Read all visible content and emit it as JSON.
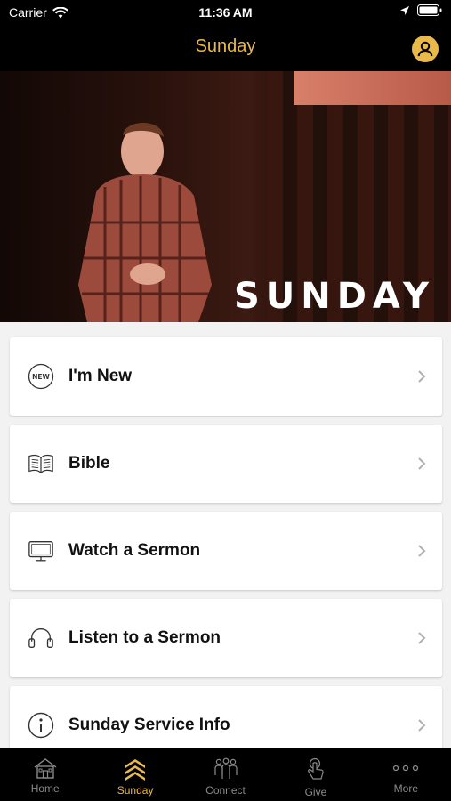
{
  "status_bar": {
    "carrier": "Carrier",
    "time": "11:36 AM"
  },
  "header": {
    "title": "Sunday",
    "profile_icon": "user-circle-icon"
  },
  "hero": {
    "title": "SUNDAY"
  },
  "menu": {
    "items": [
      {
        "label": "I'm New",
        "icon": "new-badge-icon",
        "icon_text": "NEW"
      },
      {
        "label": "Bible",
        "icon": "book-icon"
      },
      {
        "label": "Watch a Sermon",
        "icon": "monitor-icon"
      },
      {
        "label": "Listen to a Sermon",
        "icon": "headphones-icon"
      },
      {
        "label": "Sunday Service Info",
        "icon": "info-icon"
      }
    ]
  },
  "tabs": [
    {
      "label": "Home",
      "icon": "house-icon"
    },
    {
      "label": "Sunday",
      "icon": "chevrons-up-icon",
      "active": true
    },
    {
      "label": "Connect",
      "icon": "people-icon"
    },
    {
      "label": "Give",
      "icon": "hand-tap-icon"
    },
    {
      "label": "More",
      "icon": "more-dots-icon"
    }
  ],
  "colors": {
    "accent": "#e9b949",
    "bar_background": "#000000",
    "inactive_tab": "#8a8a8a"
  }
}
